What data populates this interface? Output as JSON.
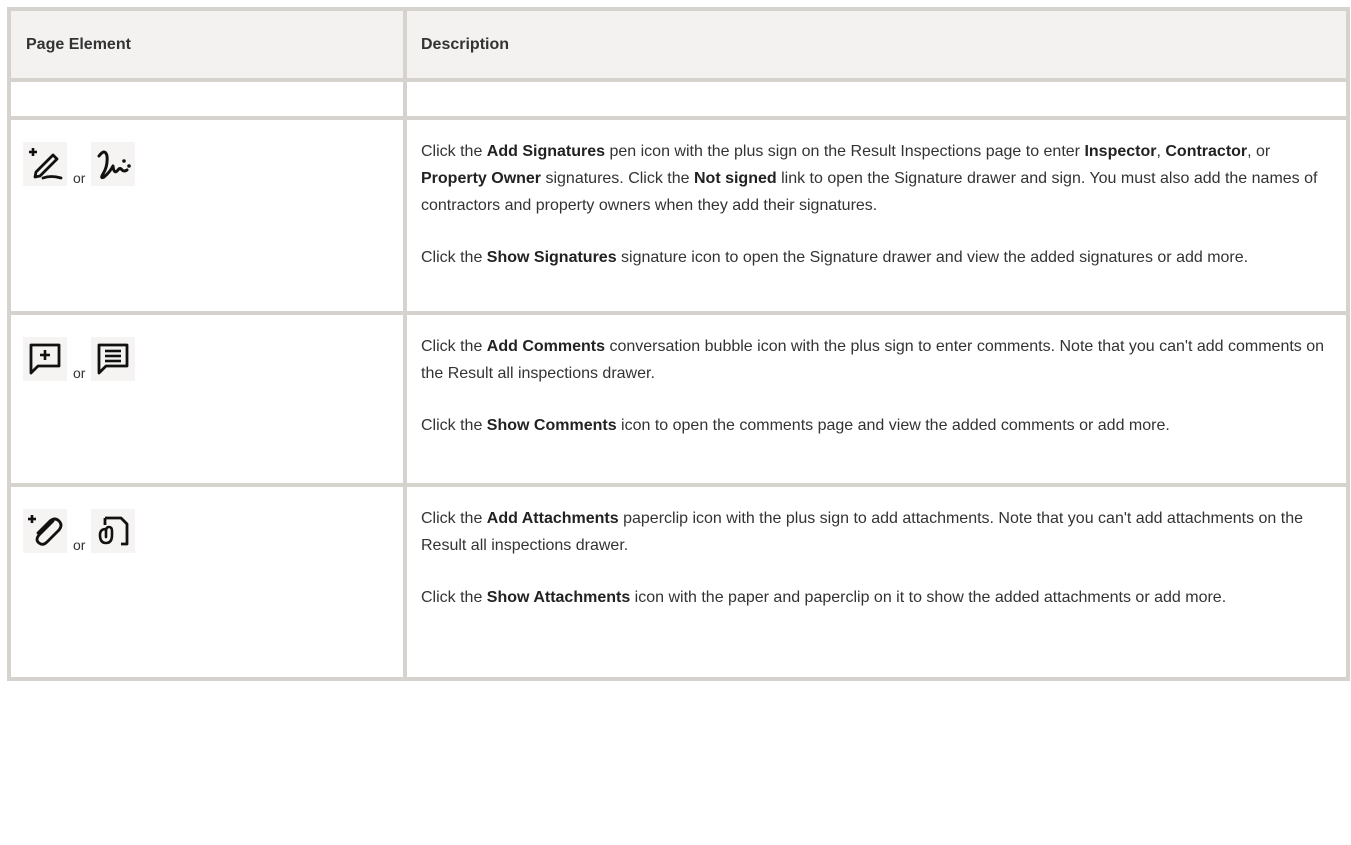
{
  "header": {
    "col1": "Page Element",
    "col2": "Description"
  },
  "rows": [
    {
      "icon_a": "add-signature-icon",
      "icon_b": "show-signatures-icon",
      "or": "or",
      "p1": [
        "Click the ",
        "Add Signatures",
        " pen icon with the plus sign on the Result Inspections page to enter ",
        "Inspector",
        ", ",
        "Contractor",
        ", or ",
        "Property Owner",
        " signatures. Click the ",
        "Not signed",
        " link to open the Signature drawer and sign. You must also add the names of contractors and property owners when they add their signatures."
      ],
      "p2": [
        "Click the ",
        "Show Signatures",
        " signature icon to open the Signature drawer and view the added signatures or add more."
      ]
    },
    {
      "icon_a": "add-comment-icon",
      "icon_b": "show-comments-icon",
      "or": "or",
      "p1": [
        "Click the ",
        "Add Comments",
        " conversation bubble icon with the plus sign to enter comments. Note that you can't add comments on the Result all inspections drawer."
      ],
      "p2": [
        "Click the ",
        "Show Comments",
        " icon to open the comments page and view the added comments or add more."
      ]
    },
    {
      "icon_a": "add-attachment-icon",
      "icon_b": "show-attachments-icon",
      "or": "or",
      "p1": [
        "Click the ",
        "Add Attachments",
        " paperclip icon with the plus sign to add attachments. Note that you can't add attachments on the Result all inspections drawer."
      ],
      "p2": [
        "Click the ",
        "Show Attachments",
        " icon with the paper and paperclip on it to show the added attachments or add more."
      ]
    }
  ]
}
